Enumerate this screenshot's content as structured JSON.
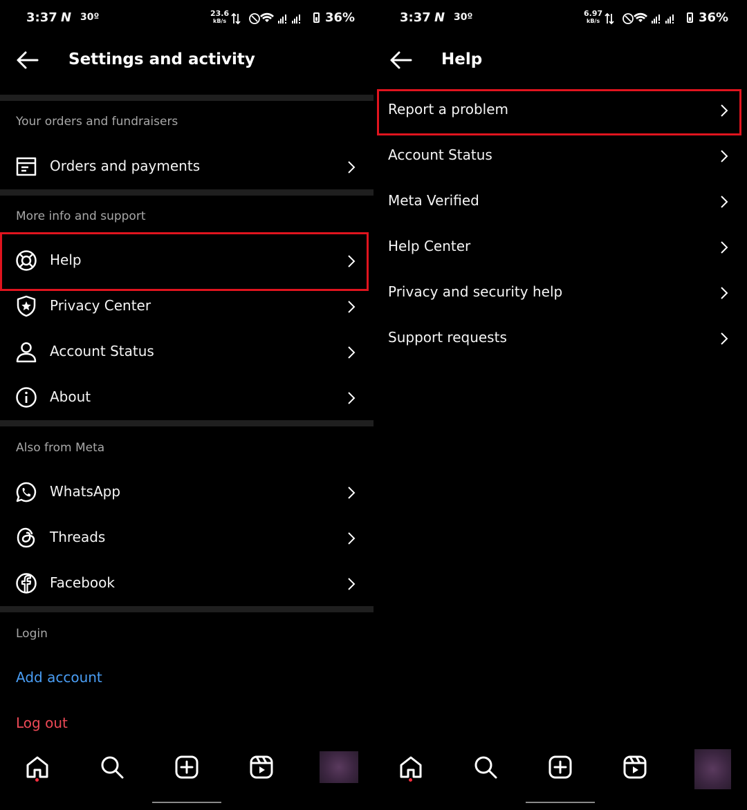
{
  "left": {
    "status_bar": {
      "time": "3:37",
      "carrier_icon": "N",
      "temperature": "30º",
      "net_speed": "23.6",
      "net_unit": "kB/s",
      "battery": "36%"
    },
    "header": {
      "title": "Settings and activity",
      "back_icon": "back-arrow-icon"
    },
    "sections": {
      "orders_label": "Your orders and fundraisers",
      "support_label": "More info and support",
      "meta_label": "Also from Meta",
      "login_label": "Login"
    },
    "items": {
      "orders": "Orders and payments",
      "help": "Help",
      "privacy": "Privacy Center",
      "account_status": "Account Status",
      "about": "About",
      "whatsapp": "WhatsApp",
      "threads": "Threads",
      "facebook": "Facebook"
    },
    "login": {
      "add_account": "Add account",
      "log_out": "Log out"
    }
  },
  "right": {
    "status_bar": {
      "time": "3:37",
      "carrier_icon": "N",
      "temperature": "30º",
      "net_speed": "6.97",
      "net_unit": "kB/s",
      "battery": "36%"
    },
    "header": {
      "title": "Help",
      "back_icon": "back-arrow-icon"
    },
    "items": {
      "report": "Report a problem",
      "account_status": "Account Status",
      "meta_verified": "Meta Verified",
      "help_center": "Help Center",
      "privacy_security": "Privacy and security help",
      "support_requests": "Support requests"
    }
  },
  "colors": {
    "background": "#000000",
    "text": "#f5f5f5",
    "muted": "#a8a8a8",
    "divider": "#1f1f1f",
    "link_blue": "#4a9ef5",
    "logout_red": "#ed4956",
    "highlight_red": "#e0141e"
  },
  "nav_icons": [
    "home-icon",
    "search-icon",
    "create-icon",
    "reels-icon",
    "profile-avatar"
  ]
}
